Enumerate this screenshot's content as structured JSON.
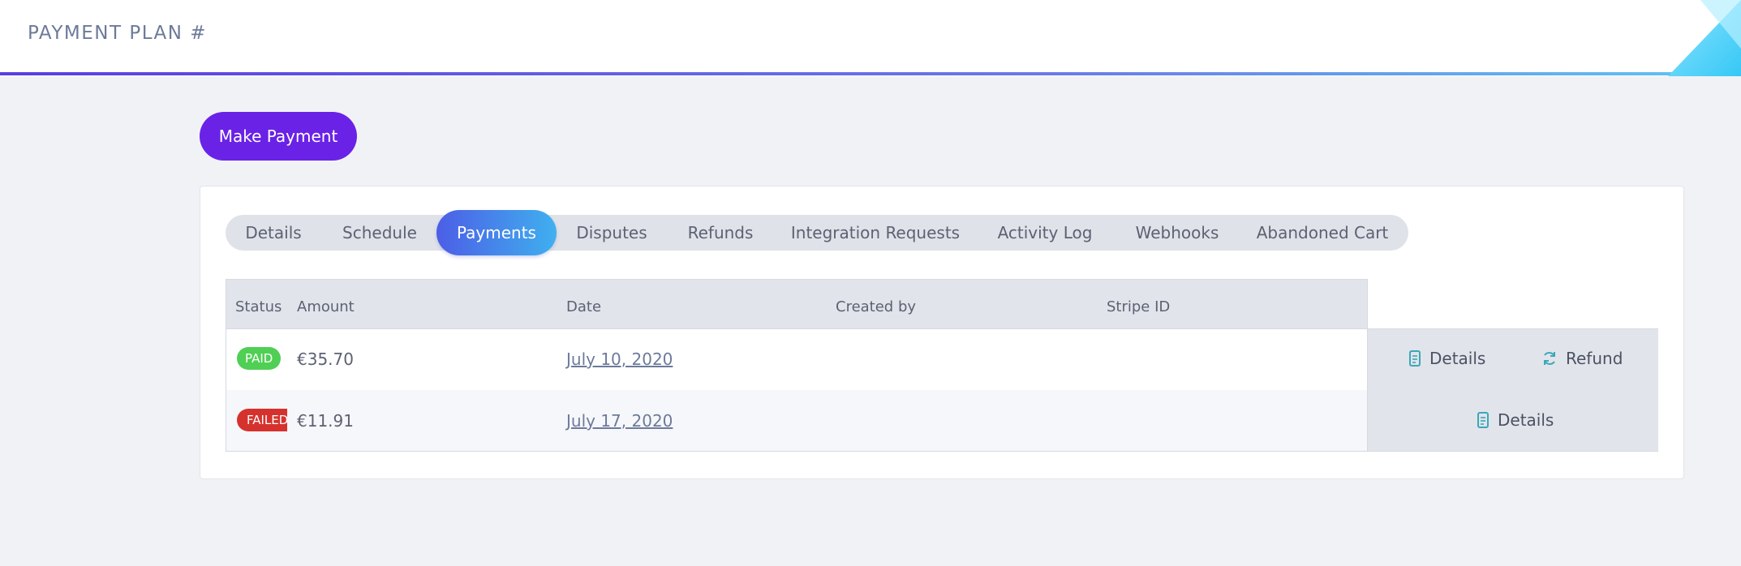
{
  "header": {
    "title": "PAYMENT PLAN #"
  },
  "make_payment_label": "Make Payment",
  "tabs": [
    {
      "label": "Details",
      "active": false
    },
    {
      "label": "Schedule",
      "active": false
    },
    {
      "label": "Payments",
      "active": true
    },
    {
      "label": "Disputes",
      "active": false
    },
    {
      "label": "Refunds",
      "active": false
    },
    {
      "label": "Integration Requests",
      "active": false
    },
    {
      "label": "Activity Log",
      "active": false
    },
    {
      "label": "Webhooks",
      "active": false
    },
    {
      "label": "Abandoned Cart",
      "active": false
    }
  ],
  "table": {
    "columns": [
      "Status",
      "Amount",
      "Date",
      "Created by",
      "Stripe ID"
    ],
    "rows": [
      {
        "status": "PAID",
        "amount": "€35.70",
        "date": "July 10, 2020",
        "created_by": "",
        "stripe_id": "",
        "actions": {
          "details": "Details",
          "refund": "Refund"
        }
      },
      {
        "status": "FAILED",
        "amount": "€11.91",
        "date": "July 17, 2020",
        "created_by": "",
        "stripe_id": "",
        "actions": {
          "details": "Details"
        }
      }
    ]
  },
  "colors": {
    "primary_button": "#6a22e6",
    "active_tab_start": "#4c5ee6",
    "active_tab_end": "#3fb0ef",
    "paid": "#4fcf54",
    "failed": "#d6322d",
    "icon_teal": "#3aa8b8"
  },
  "icons": {
    "details": "document-icon",
    "refund": "refresh-icon"
  }
}
